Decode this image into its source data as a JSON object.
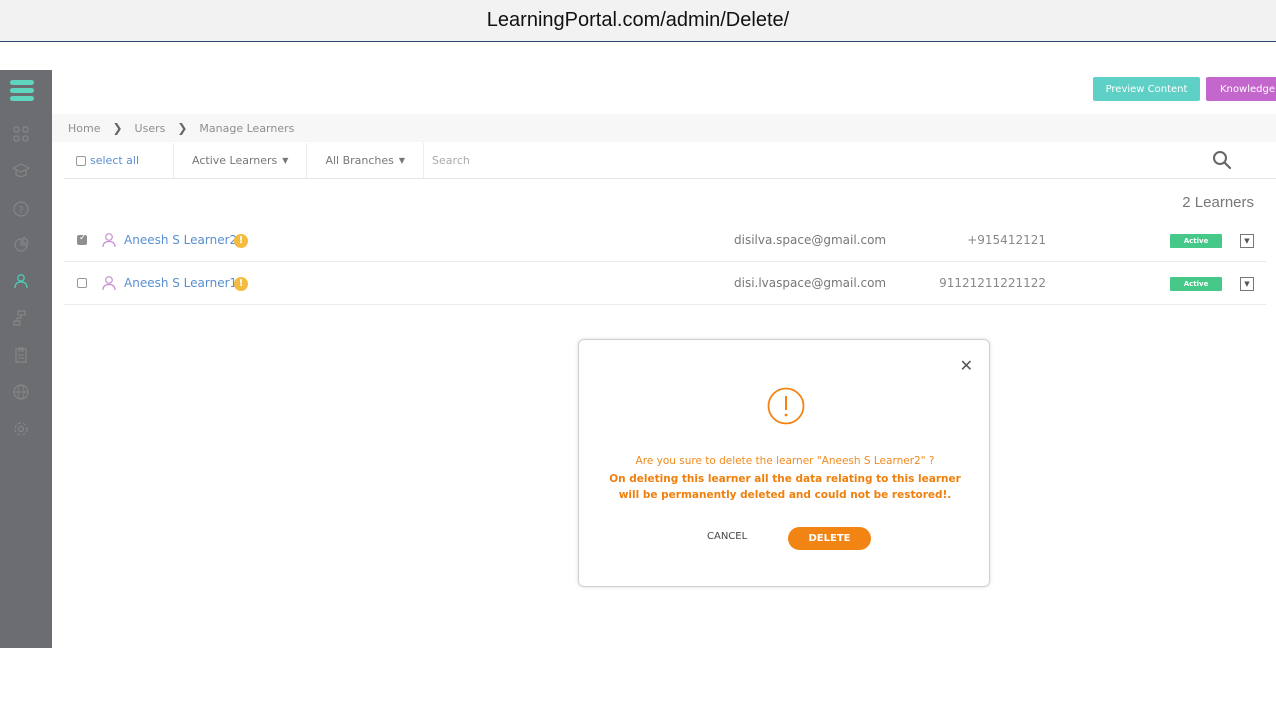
{
  "browser": {
    "url": "LearningPortal.com/admin/Delete/"
  },
  "header": {
    "preview_label": "Preview Content",
    "knowledge_label": "Knowledge Base"
  },
  "breadcrumb": {
    "items": [
      "Home",
      "Users",
      "Manage Learners"
    ]
  },
  "filters": {
    "select_all": "select all",
    "learners_dropdown": "Active Learners",
    "branches_dropdown": "All Branches",
    "search_placeholder": "Search"
  },
  "learner_count": "2 Learners",
  "learners": [
    {
      "name": "Aneesh S Learner2",
      "email": "disilva.space@gmail.com",
      "phone": "+915412121",
      "status": "Active",
      "checked": true
    },
    {
      "name": "Aneesh S Learner1",
      "email": "disi.lvaspace@gmail.com",
      "phone": "91121211221122",
      "status": "Active",
      "checked": false
    }
  ],
  "modal": {
    "question": "Are you sure to delete the learner \"Aneesh S Learner2\" ?",
    "warning": "On deleting this learner all the data relating to this learner will be permanently deleted and could not be restored!.",
    "cancel_label": "CANCEL",
    "delete_label": "DELETE"
  },
  "sidebar": {
    "icons": [
      "dashboard-icon",
      "courses-icon",
      "help-icon",
      "reports-icon",
      "users-icon",
      "hierarchy-icon",
      "clipboard-icon",
      "globe-icon",
      "settings-icon"
    ],
    "active": "users-icon"
  },
  "colors": {
    "accent": "#5ed0c6",
    "brand_purple": "#c467cc",
    "warning_orange": "#f28414",
    "active_green": "#46c889",
    "link_blue": "#5a8fcf"
  }
}
